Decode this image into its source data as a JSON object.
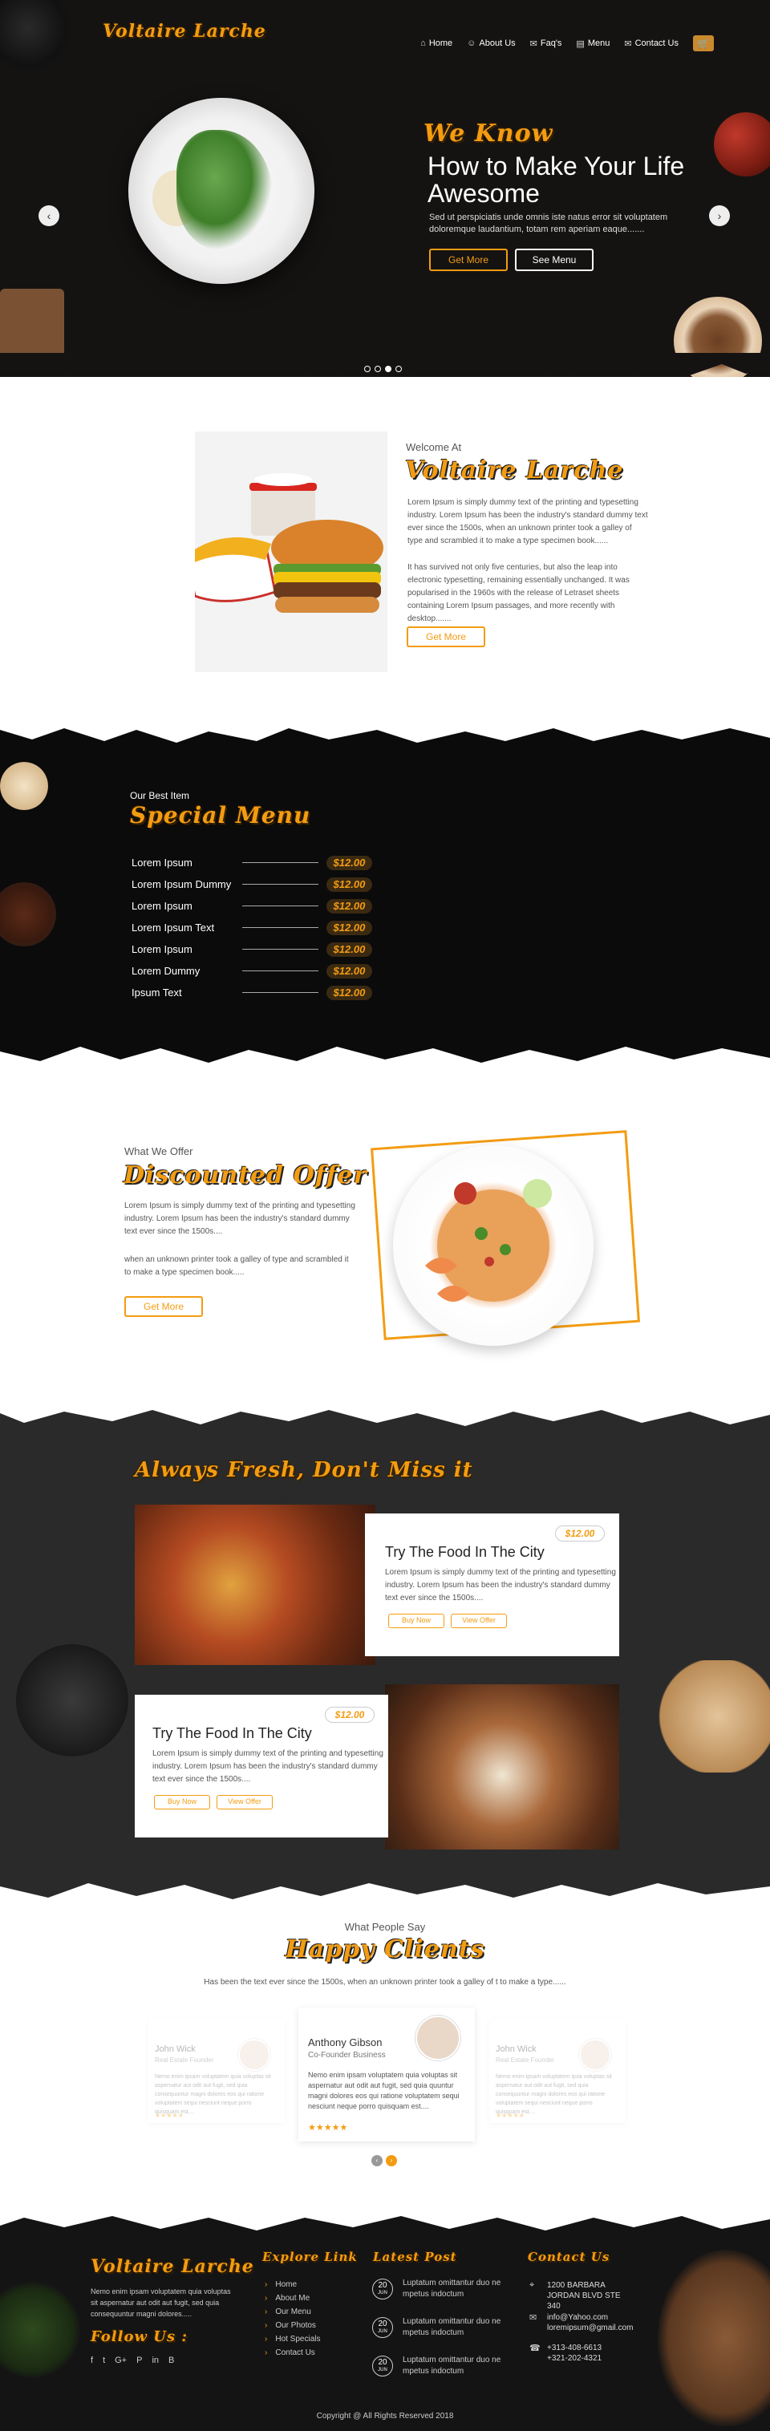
{
  "brand": {
    "logo_text": "Voltaire Larche"
  },
  "nav": {
    "items": [
      {
        "label": "Home",
        "icon": "home-icon"
      },
      {
        "label": "About Us",
        "icon": "user-icon"
      },
      {
        "label": "Faq's",
        "icon": "chat-icon"
      },
      {
        "label": "Menu",
        "icon": "menu-book-icon"
      },
      {
        "label": "Contact Us",
        "icon": "envelope-icon"
      }
    ],
    "cart_icon": "cart-icon"
  },
  "hero": {
    "tag": "We Know",
    "title": "How to Make Your Life Awesome",
    "text": "Sed ut perspiciatis unde omnis iste natus error sit voluptatem doloremque laudantium, totam rem aperiam eaque.......",
    "get_more": "Get More",
    "see_menu": "See Menu",
    "prev": "‹",
    "next": "›",
    "slide_count": 4,
    "active_slide": 3
  },
  "welcome": {
    "subtitle": "Welcome At",
    "title": "Voltaire Larche",
    "p1": "Lorem Ipsum is simply dummy text of the printing and typesetting industry. Lorem Ipsum has been the industry's standard dummy text ever since the 1500s, when an unknown printer took a galley of type and scrambled it to make a type specimen book......",
    "p2": "It has survived not only five centuries, but also the leap into electronic typesetting, remaining essentially unchanged. It was popularised in the 1960s with the release of Letraset sheets containing Lorem Ipsum passages, and more recently with desktop.......",
    "button": "Get More"
  },
  "special_menu": {
    "subtitle": "Our Best Item",
    "title": "Special Menu",
    "items": [
      {
        "name": "Lorem Ipsum",
        "price": "$12.00"
      },
      {
        "name": "Lorem Ipsum Dummy",
        "price": "$12.00"
      },
      {
        "name": "Lorem Ipsum",
        "price": "$12.00"
      },
      {
        "name": "Lorem Ipsum Text",
        "price": "$12.00"
      },
      {
        "name": "Lorem Ipsum",
        "price": "$12.00"
      },
      {
        "name": "Lorem Dummy",
        "price": "$12.00"
      },
      {
        "name": "Ipsum Text",
        "price": "$12.00"
      }
    ]
  },
  "discount": {
    "subtitle": "What We Offer",
    "title": "Discounted Offer",
    "p1": "Lorem Ipsum is simply dummy text of the printing and typesetting industry. Lorem Ipsum has been the industry's standard dummy text ever since the 1500s....",
    "p2": "when an unknown printer took a galley of type and scrambled it to make a type specimen book.....",
    "button": "Get More"
  },
  "fresh": {
    "title": "Always Fresh, Don't Miss it",
    "cards": [
      {
        "price": "$12.00",
        "title": "Try The Food In The City",
        "text": "Lorem Ipsum is simply dummy text of the printing and typesetting industry. Lorem Ipsum has been the industry's standard dummy text ever since the 1500s....",
        "buy": "Buy Now",
        "view": "View Offer"
      },
      {
        "price": "$12.00",
        "title": "Try The Food In The City",
        "text": "Lorem Ipsum is simply dummy text of the printing and typesetting industry. Lorem Ipsum has been the industry's standard dummy text ever since the 1500s....",
        "buy": "Buy Now",
        "view": "View Offer"
      }
    ]
  },
  "clients": {
    "subtitle": "What People Say",
    "title": "Happy Clients",
    "desc": "Has been the text ever since the 1500s, when an unknown printer took a galley of t to make a type......",
    "testimonials": [
      {
        "name": "John Wick",
        "role": "Real Estate Founder",
        "text": "Nemo enim ipsam voluptatem quia voluptas sit aspernatur aut odit aut fugit, sed quia consequuntur magni dolores eos qui ratione voluptatem sequi nesciunt neque porro quisquam est....",
        "stars": "★★★★★"
      },
      {
        "name": "Anthony Gibson",
        "role": "Co-Founder Business",
        "text": "Nemo enim ipsam voluptatem quia voluptas sit aspernatur aut odit aut fugit, sed quia quuntur magni dolores eos qui ratione voluptatem sequi nesciunt neque porro quisquam est....",
        "stars": "★★★★★"
      },
      {
        "name": "John Wick",
        "role": "Real Estate Founder",
        "text": "Nemo enim ipsam voluptatem quia voluptas sit aspernatur aut odit aut fugit, sed quia consequuntur magni dolores eos qui ratione voluptatem sequi nesciunt neque porro quisquam est....",
        "stars": "★★★★★"
      }
    ],
    "prev": "‹",
    "next": "›"
  },
  "footer": {
    "logo_text": "Voltaire Larche",
    "about": "Nemo enim ipsam voluptatem quia voluptas sit aspernatur aut odit aut fugit, sed quia consequuntur magni dolores.....",
    "follow": "Follow Us :",
    "social": [
      "f",
      "t",
      "G+",
      "P",
      "in",
      "B"
    ],
    "links_head": "Explore Link",
    "links": [
      "Home",
      "About Me",
      "Our Menu",
      "Our Photos",
      "Hot Specials",
      "Contact Us"
    ],
    "posts_head": "Latest Post",
    "posts": [
      {
        "day": "20",
        "month": "JUN",
        "text": "Luptatum omittantur duo ne mpetus indoctum"
      },
      {
        "day": "20",
        "month": "JUN",
        "text": "Luptatum omittantur duo ne mpetus indoctum"
      },
      {
        "day": "20",
        "month": "JUN",
        "text": "Luptatum omittantur duo ne mpetus indoctum"
      }
    ],
    "contact_head": "Contact Us",
    "contacts": [
      {
        "icon": "map-pin-icon",
        "text": "1200 BARBARA JORDAN BLVD STE 340"
      },
      {
        "icon": "envelope-icon",
        "text": "info@Yahoo.com\nloremipsum@gmail.com"
      },
      {
        "icon": "phone-icon",
        "text": "+313-408-6613\n+321-202-4321"
      }
    ],
    "copyright": "Copyright @ All Rights Reserved 2018"
  }
}
